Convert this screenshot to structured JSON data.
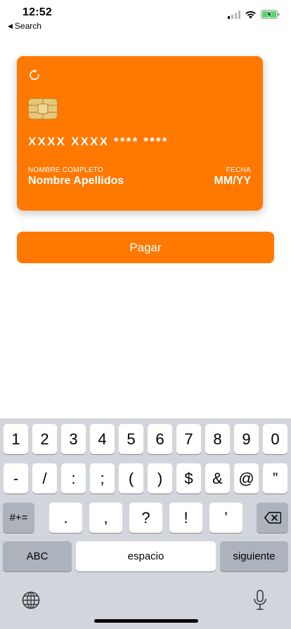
{
  "status_bar": {
    "time": "12:52",
    "back_label": "Search"
  },
  "card": {
    "number": "XXXX XXXX **** ****",
    "name_label": "NOMBRE COMPLETO",
    "name_value": "Nombre Apellidos",
    "date_label": "FECHA",
    "date_value": "MM/YY",
    "color": "#ff7800"
  },
  "pay_button": {
    "label": "Pagar"
  },
  "keyboard": {
    "row1": [
      "1",
      "2",
      "3",
      "4",
      "5",
      "6",
      "7",
      "8",
      "9",
      "0"
    ],
    "row2": [
      "-",
      "/",
      ":",
      ";",
      "(",
      ")",
      "$",
      "&",
      "@",
      "”"
    ],
    "row3": [
      ".",
      ",",
      "?",
      "!",
      "’"
    ],
    "symbols_label": "#+=",
    "abc_label": "ABC",
    "space_label": "espacio",
    "next_label": "siguiente",
    "icons": [
      "backspace-icon",
      "globe-icon",
      "microphone-icon"
    ]
  }
}
